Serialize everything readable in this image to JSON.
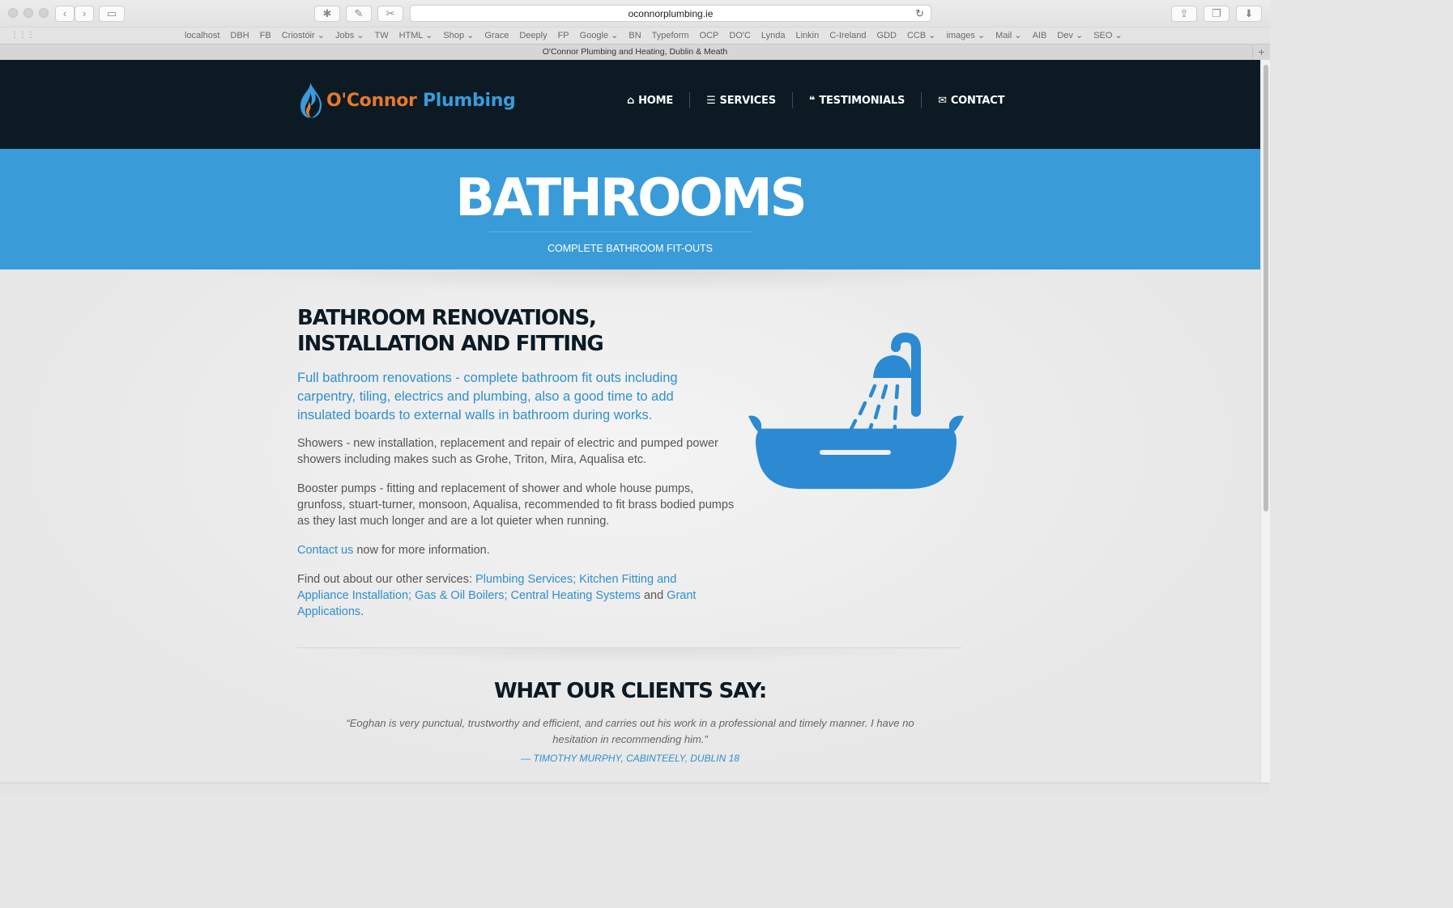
{
  "browser": {
    "url": "oconnorplumbing.ie",
    "tab_title": "O'Connor Plumbing and Heating, Dublin & Meath",
    "bookmarks": [
      "localhost",
      "DBH",
      "FB",
      "Criostóir ⌄",
      "Jobs ⌄",
      "TW",
      "HTML ⌄",
      "Shop ⌄",
      "Grace",
      "Deeply",
      "FP",
      "Google ⌄",
      "BN",
      "Typeform",
      "OCP",
      "DO'C",
      "Lynda",
      "Linkin",
      "C-Ireland",
      "GDD",
      "CCB ⌄",
      "images ⌄",
      "Mail ⌄",
      "AIB",
      "Dev ⌄",
      "SEO ⌄"
    ]
  },
  "header": {
    "logo_oconnor": "O'Connor",
    "logo_plumbing": "Plumbing",
    "nav": {
      "home": "HOME",
      "services": "SERVICES",
      "testimonials": "TESTIMONIALS",
      "contact": "CONTACT"
    }
  },
  "hero": {
    "title": "BATHROOMS",
    "subtitle": "COMPLETE BATHROOM FIT-OUTS"
  },
  "main": {
    "heading": "BATHROOM RENOVATIONS, INSTALLATION AND FITTING",
    "lead": "Full bathroom renovations - complete bathroom fit outs including carpentry, tiling, electrics and plumbing, also a good time to add insulated boards to external walls in bathroom during works.",
    "showers": "Showers - new installation, replacement and repair of electric and pumped power showers including makes such as Grohe, Triton, Mira, Aqualisa etc.",
    "booster": "Booster pumps - fitting and replacement of shower and whole house pumps, grunfoss, stuart-turner, monsoon, Aqualisa, recommended to fit brass bodied pumps as they last much longer and are a lot quieter when running.",
    "contact_link": "Contact us",
    "contact_rest": " now for more information.",
    "other_prefix": "Find out about our other services: ",
    "other_link1": "Plumbing Services; Kitchen Fitting and Appliance Installation; Gas & Oil Boilers; Central Heating Systems",
    "other_and": " and ",
    "other_link2": "Grant Applications",
    "other_end": "."
  },
  "testimonials": {
    "heading": "WHAT OUR CLIENTS SAY:",
    "quote": "“Eoghan is very punctual, trustworthy and efficient, and carries out his work in a professional and timely manner. I have no hesitation in recommending him.”",
    "cite": "— TIMOTHY MURPHY, CABINTEELY, DUBLIN 18"
  },
  "colors": {
    "header_bg": "#0c1a24",
    "brand_blue": "#3a9bd9",
    "brand_orange": "#e8792b",
    "link_blue": "#2f8fce"
  }
}
